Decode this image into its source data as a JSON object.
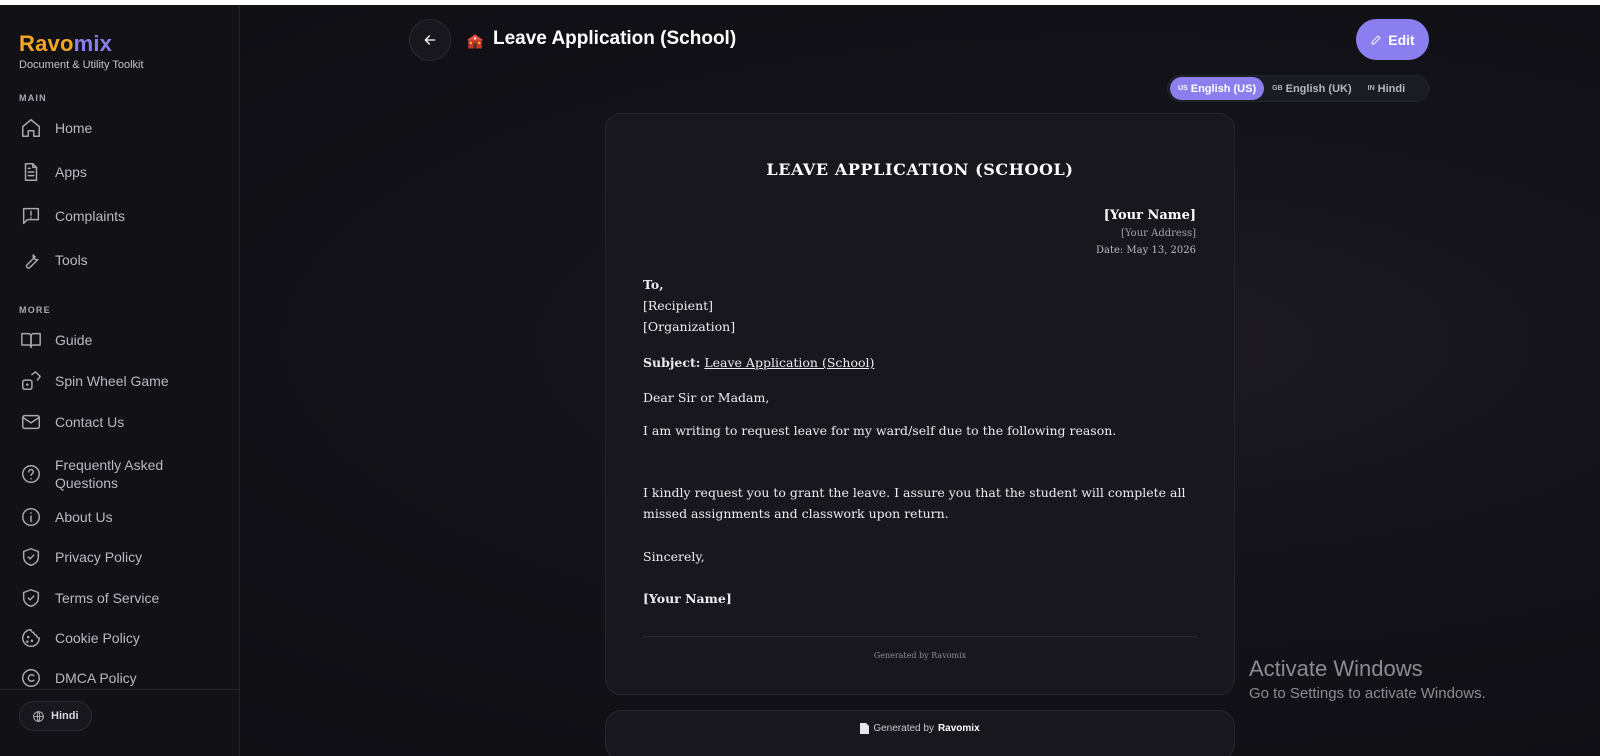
{
  "sidebar": {
    "brand_part1": "Ravo",
    "brand_part2": "mix",
    "tagline": "Document & Utility Toolkit",
    "section_main": "MAIN",
    "section_more": "MORE",
    "main_items": [
      {
        "label": "Home",
        "icon": "home-icon"
      },
      {
        "label": "Apps",
        "icon": "document-icon"
      },
      {
        "label": "Complaints",
        "icon": "message-alert-icon"
      },
      {
        "label": "Tools",
        "icon": "wrench-icon"
      }
    ],
    "more_items": [
      {
        "label": "Guide",
        "icon": "book-icon"
      },
      {
        "label": "Spin Wheel Game",
        "icon": "dice-icon"
      },
      {
        "label": "Contact Us",
        "icon": "mail-icon"
      },
      {
        "label": "Frequently Asked Questions",
        "icon": "help-circle-icon"
      },
      {
        "label": "About Us",
        "icon": "info-icon"
      },
      {
        "label": "Privacy Policy",
        "icon": "shield-check-icon"
      },
      {
        "label": "Terms of Service",
        "icon": "shield-check-icon"
      },
      {
        "label": "Cookie Policy",
        "icon": "cookie-icon"
      },
      {
        "label": "DMCA Policy",
        "icon": "copyright-icon"
      }
    ],
    "language_button": "Hindi"
  },
  "header": {
    "title": "Leave Application (School)",
    "edit_label": "Edit"
  },
  "languages": [
    {
      "code": "US",
      "label": "English (US)",
      "active": true
    },
    {
      "code": "GB",
      "label": "English (UK)",
      "active": false
    },
    {
      "code": "IN",
      "label": "Hindi",
      "active": false
    }
  ],
  "document": {
    "title": "LEAVE APPLICATION (SCHOOL)",
    "sender_name": "[Your Name]",
    "sender_address": "[Your Address]",
    "date": "Date: May 13, 2026",
    "to": "To,",
    "recipient": "[Recipient]",
    "organization": "[Organization]",
    "subject_label": "Subject:",
    "subject": "Leave Application (School)",
    "salutation": "Dear Sir or Madam,",
    "paragraph1": "I am writing to request leave for my ward/self due to the following reason.",
    "paragraph2": "I kindly request you to grant the leave. I assure you that the student will complete all missed assignments and classwork upon return.",
    "closing": "Sincerely,",
    "signature": "[Your Name]",
    "footer": "Generated by Ravomix"
  },
  "bottom_bar": {
    "generated_prefix": "Generated by",
    "generated_brand": "Ravomix"
  },
  "watermark": {
    "title": "Activate Windows",
    "subtitle": "Go to Settings to activate Windows."
  },
  "colors": {
    "accent": "#8b7ff0",
    "brand_orange": "#f5a623",
    "background": "#121218"
  }
}
